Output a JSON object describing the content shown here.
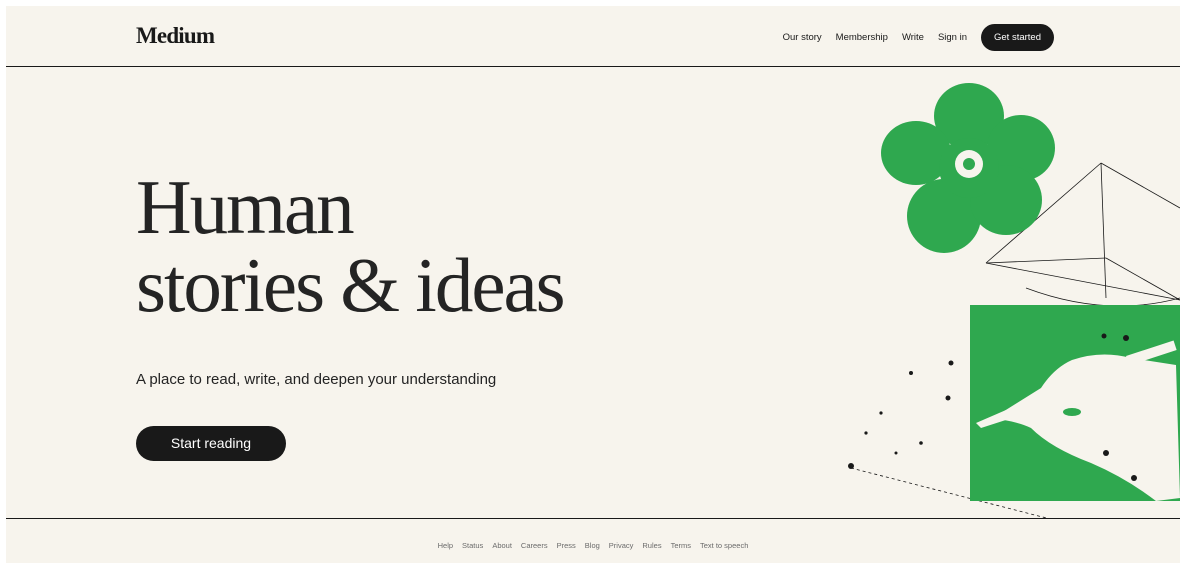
{
  "brand": {
    "logo": "Medium",
    "accent_color": "#2fa84f",
    "background_color": "#f7f4ed",
    "text_color": "#191919"
  },
  "header": {
    "nav": [
      {
        "label": "Our story"
      },
      {
        "label": "Membership"
      },
      {
        "label": "Write"
      },
      {
        "label": "Sign in"
      }
    ],
    "cta_label": "Get started"
  },
  "hero": {
    "title_line1": "Human",
    "title_line2": "stories & ideas",
    "subtitle": "A place to read, write, and deepen your understanding",
    "cta_label": "Start reading"
  },
  "footer": {
    "links": [
      {
        "label": "Help"
      },
      {
        "label": "Status"
      },
      {
        "label": "About"
      },
      {
        "label": "Careers"
      },
      {
        "label": "Press"
      },
      {
        "label": "Blog"
      },
      {
        "label": "Privacy"
      },
      {
        "label": "Rules"
      },
      {
        "label": "Terms"
      },
      {
        "label": "Text to speech"
      }
    ]
  },
  "illustration": {
    "icon": "flower-and-writing-hand-illustration"
  }
}
